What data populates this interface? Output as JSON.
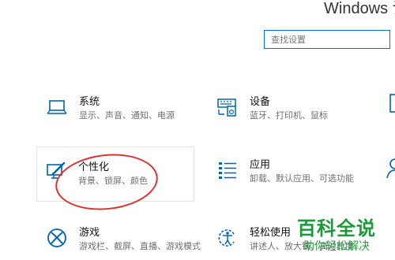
{
  "window": {
    "title": "Windows 设"
  },
  "search": {
    "placeholder": "查找设置"
  },
  "tiles": [
    {
      "title": "系统",
      "desc": "显示、声音、通知、电源",
      "icon": "laptop-icon"
    },
    {
      "title": "设备",
      "desc": "蓝牙、打印机、鼠标",
      "icon": "keyboard-printer-icon"
    },
    {
      "title": "个性化",
      "desc": "背景、锁屏、颜色",
      "icon": "paint-tablet-icon"
    },
    {
      "title": "应用",
      "desc": "卸载、默认应用、可选功能",
      "icon": "apps-list-icon"
    },
    {
      "title": "游戏",
      "desc": "游戏栏、截屏、直播、游戏模式",
      "icon": "xbox-icon"
    },
    {
      "title": "轻松使用",
      "desc": "讲述人、放大镜、高对比度",
      "icon": "ease-of-access-icon"
    }
  ],
  "watermark": {
    "main": "百科全说",
    "sub": "助你轻松解决"
  },
  "colors": {
    "accent": "#0078d7",
    "annotation": "#e03030",
    "watermark": "#1c9a3a"
  }
}
